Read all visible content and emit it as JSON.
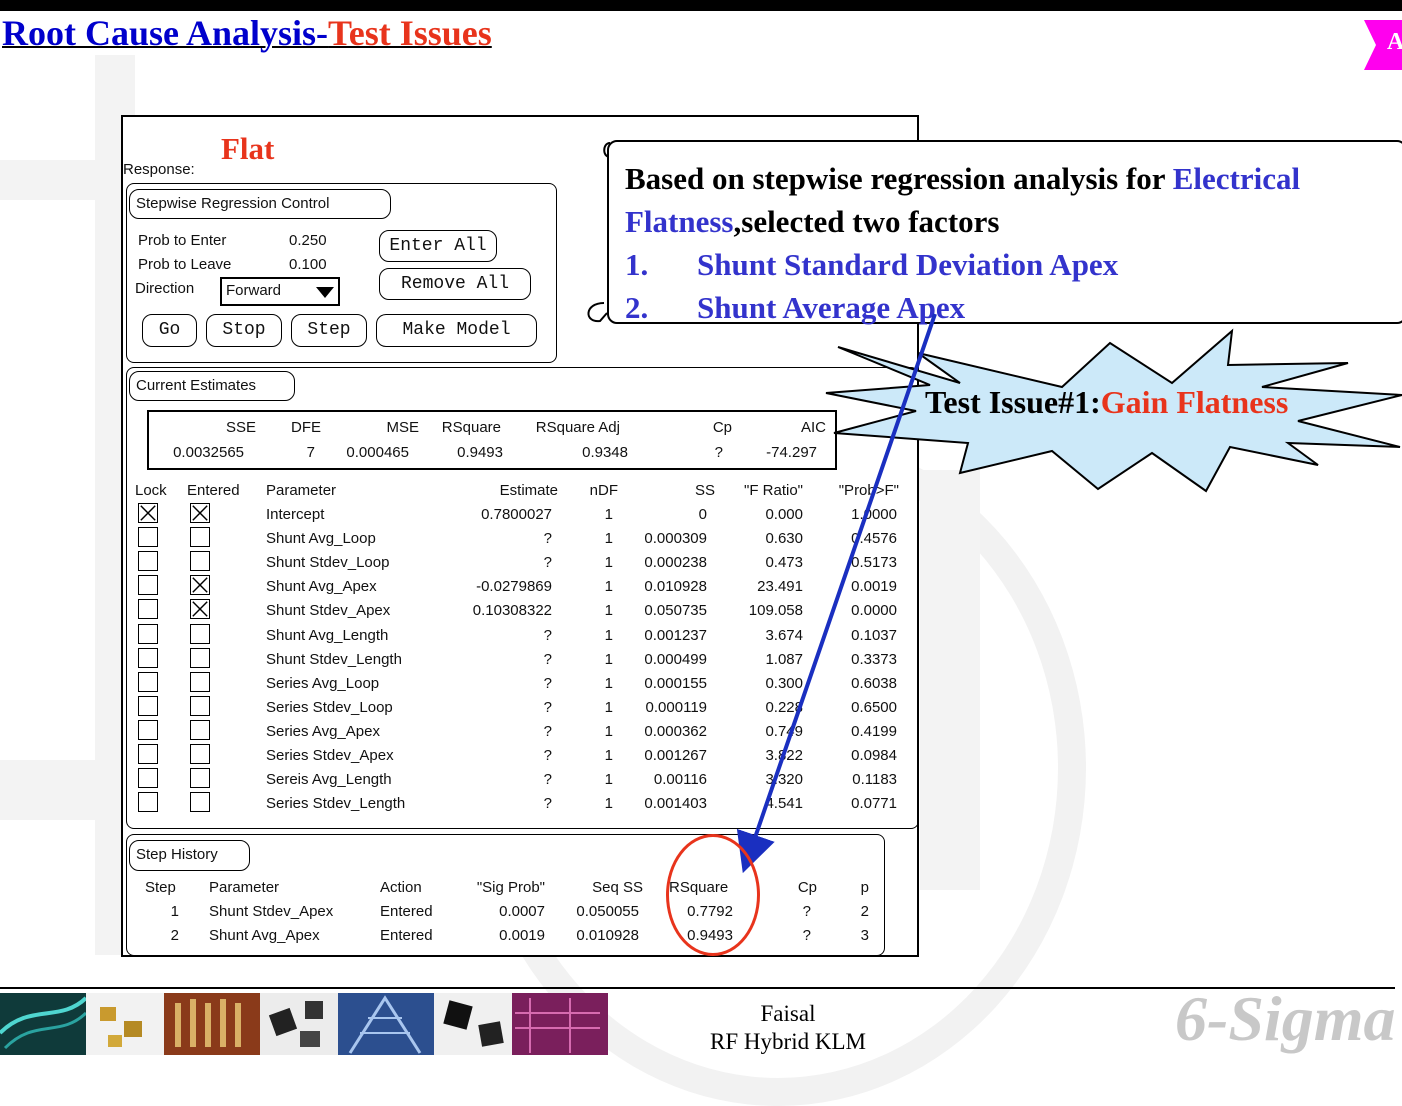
{
  "slide": {
    "title_part1": "Root Cause Analysis-",
    "title_part2": "Test Issues",
    "corner_tab": "A"
  },
  "panel": {
    "response_label": "Response:",
    "response_value": "Flat",
    "control": {
      "title": "Stepwise Regression Control",
      "prob_enter_label": "Prob to Enter",
      "prob_enter_value": "0.250",
      "prob_leave_label": "Prob to Leave",
      "prob_leave_value": "0.100",
      "direction_label": "Direction",
      "direction_value": "Forward",
      "buttons": {
        "enter_all": "Enter All",
        "remove_all": "Remove All",
        "go": "Go",
        "stop": "Stop",
        "step": "Step",
        "make_model": "Make Model"
      }
    },
    "estimates": {
      "title": "Current Estimates",
      "headers": [
        "SSE",
        "DFE",
        "MSE",
        "RSquare",
        "RSquare Adj",
        "Cp",
        "AIC"
      ],
      "values": [
        "0.0032565",
        "7",
        "0.000465",
        "0.9493",
        "0.9348",
        "?",
        "-74.297"
      ]
    },
    "params": {
      "headers": [
        "Lock",
        "Entered",
        "Parameter",
        "Estimate",
        "nDF",
        "SS",
        "\"F Ratio\"",
        "\"Prob>F\""
      ],
      "rows": [
        {
          "lock": true,
          "entered": true,
          "name": "Intercept",
          "estimate": "0.7800027",
          "ndf": "1",
          "ss": "0",
          "f": "0.000",
          "p": "1.0000"
        },
        {
          "lock": false,
          "entered": false,
          "name": "Shunt Avg_Loop",
          "estimate": "?",
          "ndf": "1",
          "ss": "0.000309",
          "f": "0.630",
          "p": "0.4576"
        },
        {
          "lock": false,
          "entered": false,
          "name": "Shunt Stdev_Loop",
          "estimate": "?",
          "ndf": "1",
          "ss": "0.000238",
          "f": "0.473",
          "p": "0.5173"
        },
        {
          "lock": false,
          "entered": true,
          "name": "Shunt Avg_Apex",
          "estimate": "-0.0279869",
          "ndf": "1",
          "ss": "0.010928",
          "f": "23.491",
          "p": "0.0019"
        },
        {
          "lock": false,
          "entered": true,
          "name": "Shunt Stdev_Apex",
          "estimate": "0.10308322",
          "ndf": "1",
          "ss": "0.050735",
          "f": "109.058",
          "p": "0.0000"
        },
        {
          "lock": false,
          "entered": false,
          "name": "Shunt Avg_Length",
          "estimate": "?",
          "ndf": "1",
          "ss": "0.001237",
          "f": "3.674",
          "p": "0.1037"
        },
        {
          "lock": false,
          "entered": false,
          "name": "Shunt Stdev_Length",
          "estimate": "?",
          "ndf": "1",
          "ss": "0.000499",
          "f": "1.087",
          "p": "0.3373"
        },
        {
          "lock": false,
          "entered": false,
          "name": "Series Avg_Loop",
          "estimate": "?",
          "ndf": "1",
          "ss": "0.000155",
          "f": "0.300",
          "p": "0.6038"
        },
        {
          "lock": false,
          "entered": false,
          "name": "Series Stdev_Loop",
          "estimate": "?",
          "ndf": "1",
          "ss": "0.000119",
          "f": "0.228",
          "p": "0.6500"
        },
        {
          "lock": false,
          "entered": false,
          "name": "Series Avg_Apex",
          "estimate": "?",
          "ndf": "1",
          "ss": "0.000362",
          "f": "0.749",
          "p": "0.4199"
        },
        {
          "lock": false,
          "entered": false,
          "name": "Series Stdev_Apex",
          "estimate": "?",
          "ndf": "1",
          "ss": "0.001267",
          "f": "3.822",
          "p": "0.0984"
        },
        {
          "lock": false,
          "entered": false,
          "name": "Sereis Avg_Length",
          "estimate": "?",
          "ndf": "1",
          "ss": "0.00116",
          "f": "3.320",
          "p": "0.1183"
        },
        {
          "lock": false,
          "entered": false,
          "name": "Series Stdev_Length",
          "estimate": "?",
          "ndf": "1",
          "ss": "0.001403",
          "f": "4.541",
          "p": "0.0771"
        }
      ]
    },
    "history": {
      "title": "Step History",
      "headers": [
        "Step",
        "Parameter",
        "Action",
        "\"Sig Prob\"",
        "Seq SS",
        "RSquare",
        "Cp",
        "p"
      ],
      "rows": [
        {
          "step": "1",
          "param": "Shunt Stdev_Apex",
          "action": "Entered",
          "sig": "0.0007",
          "seq": "0.050055",
          "rsq": "0.7792",
          "cp": "?",
          "p": "2"
        },
        {
          "step": "2",
          "param": "Shunt Avg_Apex",
          "action": "Entered",
          "sig": "0.0019",
          "seq": "0.010928",
          "rsq": "0.9493",
          "cp": "?",
          "p": "3"
        }
      ]
    }
  },
  "note": {
    "line1_black": "Based on stepwise regression analysis for ",
    "line1_blue": "Electrical",
    "line2_blue": "Flatness",
    "line2_black": ",selected two factors",
    "item1_num": "1.",
    "item1_text": "Shunt Standard Deviation Apex",
    "item2_num": "2.",
    "item2_text": "Shunt Average Apex"
  },
  "burst": {
    "label_black": "Test Issue#1:",
    "label_red": "Gain Flatness"
  },
  "footer": {
    "name": "Faisal",
    "org": "RF Hybrid KLM",
    "logo": "6-Sigma"
  },
  "colors": {
    "title_blue": "#0000cc",
    "accent_red": "#e8341c",
    "note_blue": "#3333cc",
    "burst_fill": "#cce9f9",
    "arrow_blue": "#1a2fc0",
    "tab_magenta": "#ff00ee"
  }
}
